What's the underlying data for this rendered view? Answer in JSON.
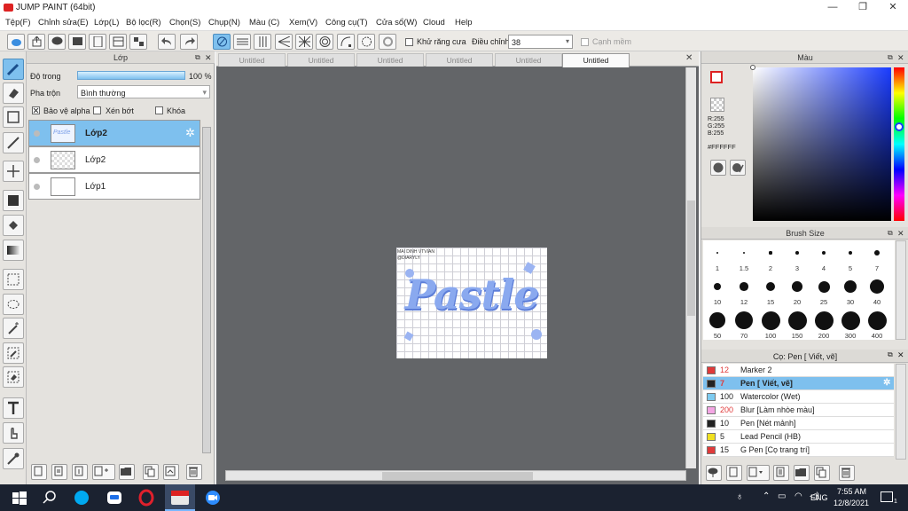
{
  "window": {
    "title": "JUMP PAINT (64bit)",
    "min": "—",
    "max": "❐",
    "close": "✕"
  },
  "menu": [
    "Tệp(F)",
    "Chỉnh sửa(E)",
    "Lớp(L)",
    "Bộ lọc(R)",
    "Chọn(S)",
    "Chụp(N)",
    "Màu (C)",
    "Xem(V)",
    "Công cụ(T)",
    "Cửa sổ(W)",
    "Cloud",
    "Help"
  ],
  "toolbar": {
    "antialias_label": "Khử răng cưa",
    "adjust_label": "Điều chỉnh",
    "adjust_value": "38",
    "snap_label": "Cạnh mềm"
  },
  "layer_panel": {
    "title": "Lớp",
    "opacity_label": "Độ trong",
    "opacity_value": "100 %",
    "opacity_fraction": 1.0,
    "blend_label": "Pha trộn",
    "blend_value": "Bình thường",
    "protect_alpha": "Bảo vệ alpha",
    "clipping": "Xén bớt",
    "lock": "Khóa",
    "layers": [
      {
        "name": "Lớp2",
        "selected": true
      },
      {
        "name": "Lớp2",
        "selected": false
      },
      {
        "name": "Lớp1",
        "selected": false
      }
    ]
  },
  "tabs": [
    "Untitled",
    "Untitled",
    "Untitled",
    "Untitled",
    "Untitled",
    "Untitled"
  ],
  "artwork": {
    "text": "Pastle",
    "caption_line1": "MAI DINH VTVIAN",
    "caption_line2": "@DIARYLY"
  },
  "color_panel": {
    "title": "Màu",
    "r": "R:255",
    "g": "G:255",
    "b": "B:255",
    "hex": "#FFFFFF"
  },
  "brush_size": {
    "title": "Brush Size",
    "sizes": [
      "1",
      "1.5",
      "2",
      "3",
      "4",
      "5",
      "7",
      "10",
      "12",
      "15",
      "20",
      "25",
      "30",
      "40",
      "50",
      "70",
      "100",
      "150",
      "200",
      "300",
      "400"
    ]
  },
  "brush_list": {
    "title": "Cọ: Pen [ Viết, vẽ]",
    "items": [
      {
        "num": "12",
        "name": "Marker 2",
        "color": "#e03a3a"
      },
      {
        "num": "7",
        "name": "Pen [ Viết, vẽ]",
        "color": "#222222"
      },
      {
        "num": "100",
        "name": "Watercolor (Wet)",
        "color": "#7ecbf0"
      },
      {
        "num": "200",
        "name": "Blur [Làm nhòe màu]",
        "color": "#f4a6e4"
      },
      {
        "num": "10",
        "name": "Pen [Nét mảnh]",
        "color": "#222222"
      },
      {
        "num": "5",
        "name": "Lead Pencil (HB)",
        "color": "#f0e020"
      },
      {
        "num": "15",
        "name": "G Pen [Cọ trang trí]",
        "color": "#e03a3a"
      }
    ]
  },
  "taskbar": {
    "lang": "ENG",
    "time": "7:55 AM",
    "date": "12/8/2021",
    "notif": "1"
  }
}
